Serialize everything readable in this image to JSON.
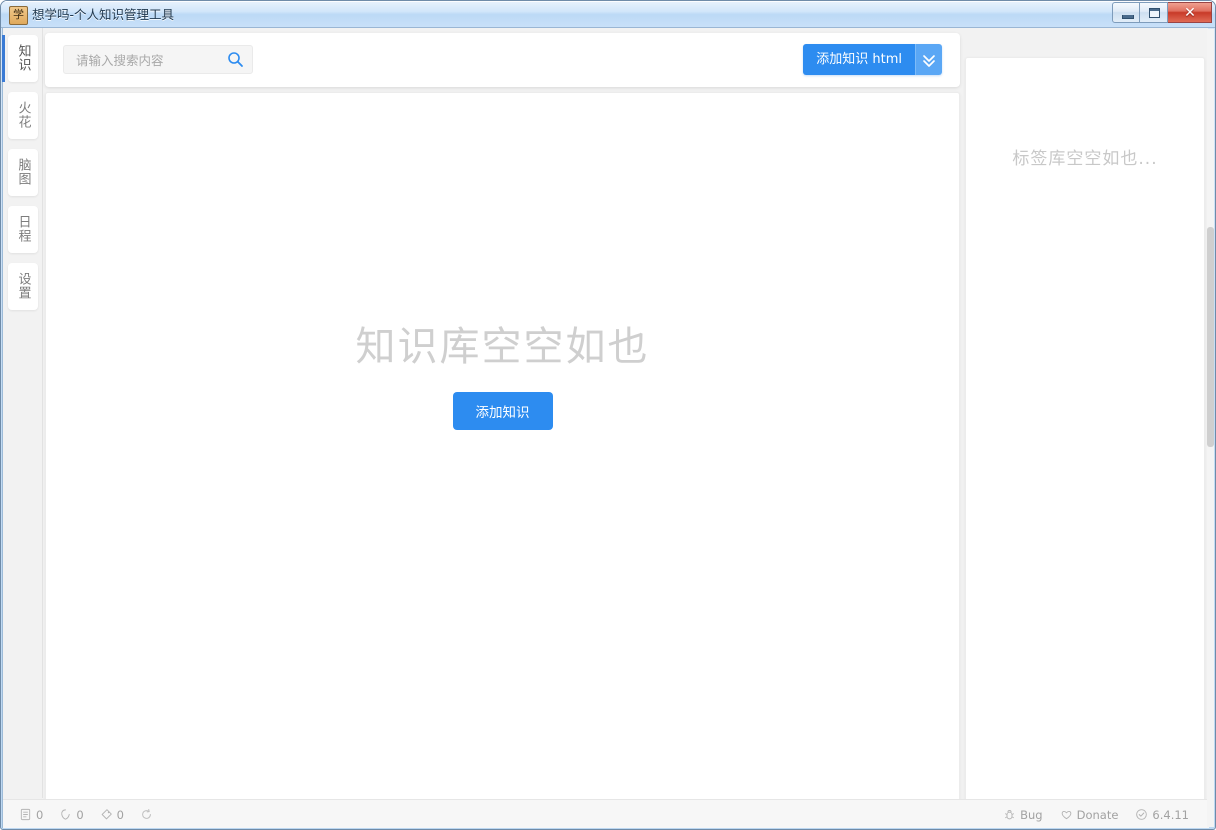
{
  "window": {
    "title": "想学吗-个人知识管理工具",
    "app_icon": "app-icon",
    "controls": {
      "minimize": "minimize-button",
      "maximize": "maximize-button",
      "close_glyph": "✕"
    }
  },
  "sidebar": {
    "items": [
      {
        "label": "知识",
        "name": "sidebar-item-knowledge",
        "active": true
      },
      {
        "label": "火花",
        "name": "sidebar-item-spark",
        "active": false
      },
      {
        "label": "脑图",
        "name": "sidebar-item-mindmap",
        "active": false
      },
      {
        "label": "日程",
        "name": "sidebar-item-schedule",
        "active": false
      },
      {
        "label": "设置",
        "name": "sidebar-item-settings",
        "active": false
      }
    ]
  },
  "toolbar": {
    "search": {
      "value": "",
      "placeholder": "请输入搜索内容",
      "icon": "search-icon"
    },
    "add_button": {
      "label": "添加知识 html",
      "caret_icon": "chevron-double-down-icon"
    }
  },
  "main": {
    "empty_title": "知识库空空如也",
    "empty_button": "添加知识"
  },
  "tag_panel": {
    "empty_text": "标签库空空如也..."
  },
  "statusbar": {
    "counters": [
      {
        "icon": "document-icon",
        "value": "0",
        "name": "knowledge-count"
      },
      {
        "icon": "spark-icon",
        "value": "0",
        "name": "spark-count"
      },
      {
        "icon": "tag-icon",
        "value": "0",
        "name": "tag-count"
      },
      {
        "icon": "refresh-icon",
        "value": "",
        "name": "sync-status"
      }
    ],
    "links": [
      {
        "icon": "bug-icon",
        "label": "Bug",
        "name": "bug-link"
      },
      {
        "icon": "heart-icon",
        "label": "Donate",
        "name": "donate-link"
      },
      {
        "icon": "check-circle-icon",
        "label": "6.4.11",
        "name": "version-label"
      }
    ]
  },
  "colors": {
    "accent": "#2d8cf0",
    "accent_light": "#5aa7f5",
    "muted_text": "#a2a2a2",
    "empty_text": "#cfcfcf",
    "title_text": "#21394f"
  }
}
